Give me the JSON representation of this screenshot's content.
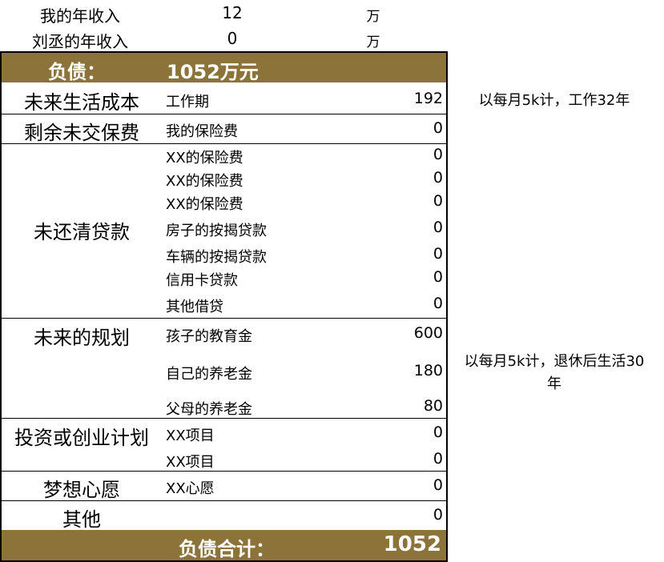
{
  "income": [
    {
      "label": "我的年收入",
      "value": "12",
      "unit": "万"
    },
    {
      "label": "刘丞的年收入",
      "value": "0",
      "unit": "万"
    }
  ],
  "header": {
    "label": "负债：",
    "value": "1052万元"
  },
  "sections": [
    {
      "category": "未来生活成本",
      "items": [
        {
          "label": "工作期",
          "value": "192"
        }
      ]
    },
    {
      "category": "剩余未交保费",
      "items": [
        {
          "label": "我的保险费",
          "value": "0"
        }
      ]
    },
    {
      "category": "未还清贷款",
      "items": [
        {
          "label": "XX的保险费",
          "value": "0"
        },
        {
          "label": "XX的保险费",
          "value": "0"
        },
        {
          "label": "XX的保险费",
          "value": "0"
        },
        {
          "label": "房子的按揭贷款",
          "value": "0"
        },
        {
          "label": "车辆的按揭贷款",
          "value": "0"
        },
        {
          "label": "信用卡贷款",
          "value": "0"
        },
        {
          "label": "其他借贷",
          "value": "0"
        }
      ]
    },
    {
      "category": "未来的规划",
      "items": [
        {
          "label": "孩子的教育金",
          "value": "600"
        },
        {
          "label": "自己的养老金",
          "value": "180"
        },
        {
          "label": "父母的养老金",
          "value": "80"
        }
      ]
    },
    {
      "category": "投资或创业计划",
      "items": [
        {
          "label": "XX项目",
          "value": "0"
        },
        {
          "label": "XX项目",
          "value": "0"
        }
      ]
    },
    {
      "category": "梦想心愿",
      "items": [
        {
          "label": "XX心愿",
          "value": "0"
        }
      ]
    },
    {
      "category": "其他",
      "items": [
        {
          "label": "",
          "value": "0"
        }
      ]
    }
  ],
  "notes": {
    "work_period": "以每月5k计，工作32年",
    "retirement_line1": "以每月5k计，退休后生活30",
    "retirement_line2": "年"
  },
  "footer": {
    "label": "负债合计：",
    "value": "1052"
  },
  "colors": {
    "band": "#8b7339",
    "band_text": "#ffffff"
  }
}
